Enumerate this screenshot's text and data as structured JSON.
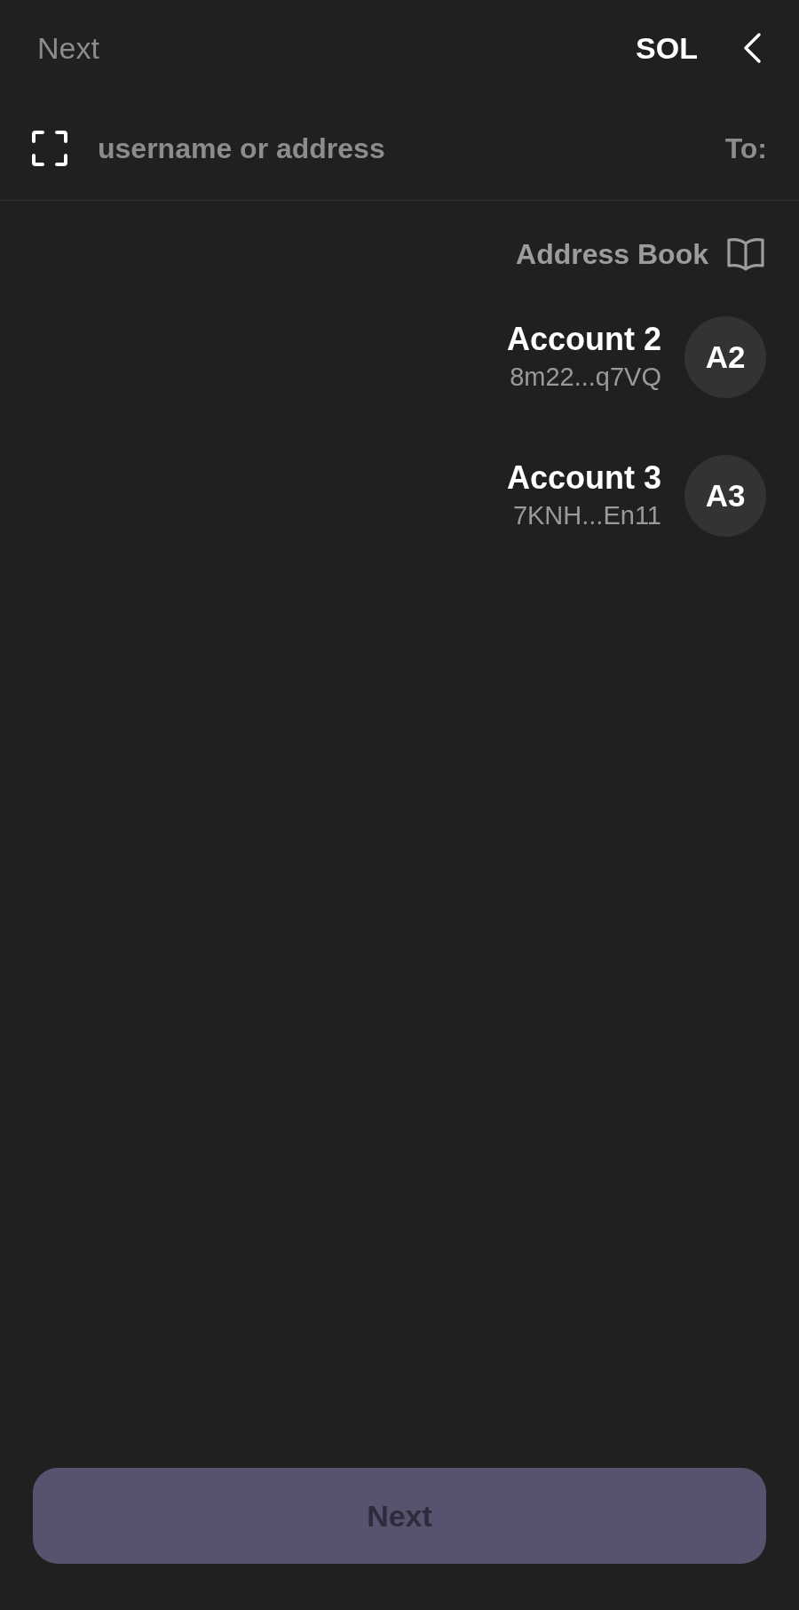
{
  "header": {
    "action": "Next",
    "token": "SOL"
  },
  "recipient": {
    "placeholder": "username or address",
    "label": "To:"
  },
  "address_book": {
    "label": "Address Book"
  },
  "accounts": [
    {
      "avatar": "A2",
      "name": "Account 2",
      "address": "8m22...q7VQ"
    },
    {
      "avatar": "A3",
      "name": "Account 3",
      "address": "7KNH...En11"
    }
  ],
  "next_button": {
    "label": "Next",
    "disabled": true
  }
}
